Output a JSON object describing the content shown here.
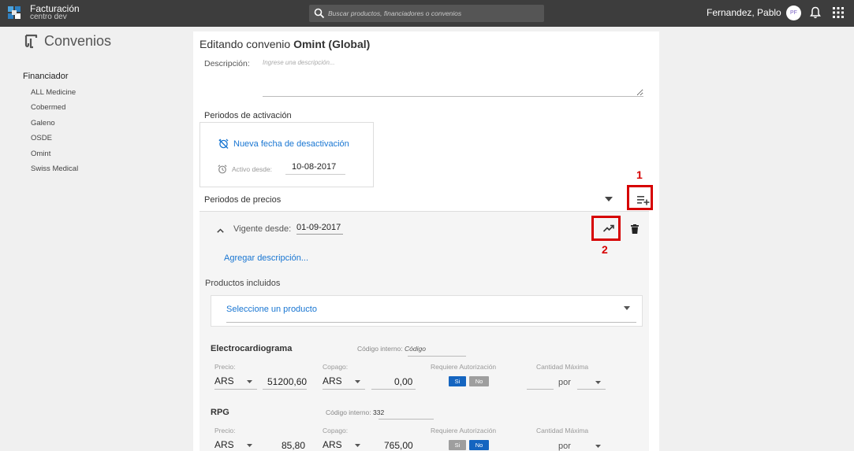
{
  "header": {
    "app_title": "Facturación",
    "app_subtitle": "centro dev",
    "search_placeholder": "Buscar productos, financiadores o convenios",
    "user_name": "Fernandez, Pablo",
    "avatar_initials": "PF",
    "icons": [
      "app-logo-icon",
      "search-icon",
      "bell-icon",
      "apps-grid-icon"
    ]
  },
  "sidebar": {
    "title": "Convenios",
    "financiador_label": "Financiador",
    "items": [
      {
        "label": "ALL Medicine"
      },
      {
        "label": "Cobermed"
      },
      {
        "label": "Galeno"
      },
      {
        "label": "OSDE"
      },
      {
        "label": "Omint"
      },
      {
        "label": "Swiss Medical"
      }
    ]
  },
  "main": {
    "title_prefix": "Editando convenio",
    "title_name": "Omint (Global)",
    "descripcion_label": "Descripción:",
    "descripcion_placeholder": "Ingrese una descripción...",
    "activation": {
      "heading": "Periodos de activación",
      "new_deactivation": "Nueva fecha de desactivación",
      "activo_label": "Activo desde:",
      "activo_value": "10-08-2017"
    },
    "prices": {
      "heading": "Periodos de precios",
      "vigente_label": "Vigente desde:",
      "vigente_value": "01-09-2017",
      "agregar_desc": "Agregar descripción...",
      "productos_label": "Productos incluidos",
      "select_placeholder": "Seleccione un producto",
      "products": [
        {
          "name": "Electrocardiograma",
          "codigo_label": "Código interno:",
          "codigo_value": "Código",
          "precio_label": "Precio:",
          "precio_currency": "ARS",
          "precio_value": "51200,60",
          "copago_label": "Copago:",
          "copago_currency": "ARS",
          "copago_value": "0,00",
          "autorizacion_label": "Requiere Autorización",
          "si_label": "Si",
          "no_label": "No",
          "autorizacion_selected": "Si",
          "cantidad_label": "Cantidad Máxima",
          "cantidad_value": "",
          "por_label": "por"
        },
        {
          "name": "RPG",
          "codigo_label": "Código interno:",
          "codigo_value": "332",
          "precio_label": "Precio:",
          "precio_currency": "ARS",
          "precio_value": "85,80",
          "copago_label": "Copago:",
          "copago_currency": "ARS",
          "copago_value": "765,00",
          "autorizacion_label": "Requiere Autorización",
          "si_label": "Si",
          "no_label": "No",
          "autorizacion_selected": "No",
          "cantidad_label": "Cantidad Máxima",
          "cantidad_value": "",
          "por_label": "por"
        }
      ]
    }
  },
  "annotations": {
    "callout_1": "1",
    "callout_2": "2",
    "color": "#d60000"
  },
  "colors": {
    "topbar": "#3d3d3d",
    "accent": "#1976d2",
    "toggle_active": "#1565c0",
    "toggle_inactive": "#9e9e9e"
  }
}
